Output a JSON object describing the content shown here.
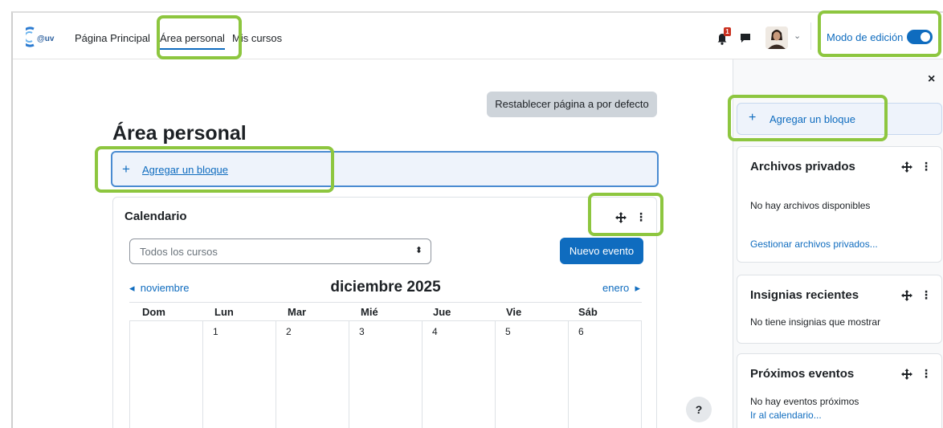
{
  "navbar": {
    "logo_text": "Ceuv",
    "links": [
      "Página Principal",
      "Área personal",
      "Mis cursos"
    ],
    "notification_count": "1",
    "edit_mode_label": "Modo de edición"
  },
  "main": {
    "reset_button": "Restablecer página a por defecto",
    "page_title": "Área personal",
    "add_block": {
      "icon": "+",
      "label": "Agregar un bloque"
    }
  },
  "calendar": {
    "title": "Calendario",
    "course_select": "Todos los cursos",
    "new_event_button": "Nuevo evento",
    "prev_month": "noviembre",
    "next_month": "enero",
    "month_title": "diciembre 2025",
    "weekdays": [
      "Dom",
      "Lun",
      "Mar",
      "Mié",
      "Jue",
      "Vie",
      "Sáb"
    ],
    "days": [
      "",
      "1",
      "2",
      "3",
      "4",
      "5",
      "6"
    ]
  },
  "help_button": "?",
  "drawer": {
    "close": "×",
    "add_block": {
      "icon": "+",
      "label": "Agregar un bloque"
    },
    "blocks": [
      {
        "title": "Archivos privados",
        "text": "No hay archivos disponibles",
        "link": "Gestionar archivos privados..."
      },
      {
        "title": "Insignias recientes",
        "text": "No tiene insignias que mostrar"
      },
      {
        "title": "Próximos eventos",
        "text": "No hay eventos próximos",
        "link": "Ir al calendario..."
      }
    ]
  },
  "colors": {
    "primary": "#0f6cbf",
    "highlight": "#8dc63f",
    "reset_button_bg": "#ced4da",
    "badge": "#ca3120"
  }
}
